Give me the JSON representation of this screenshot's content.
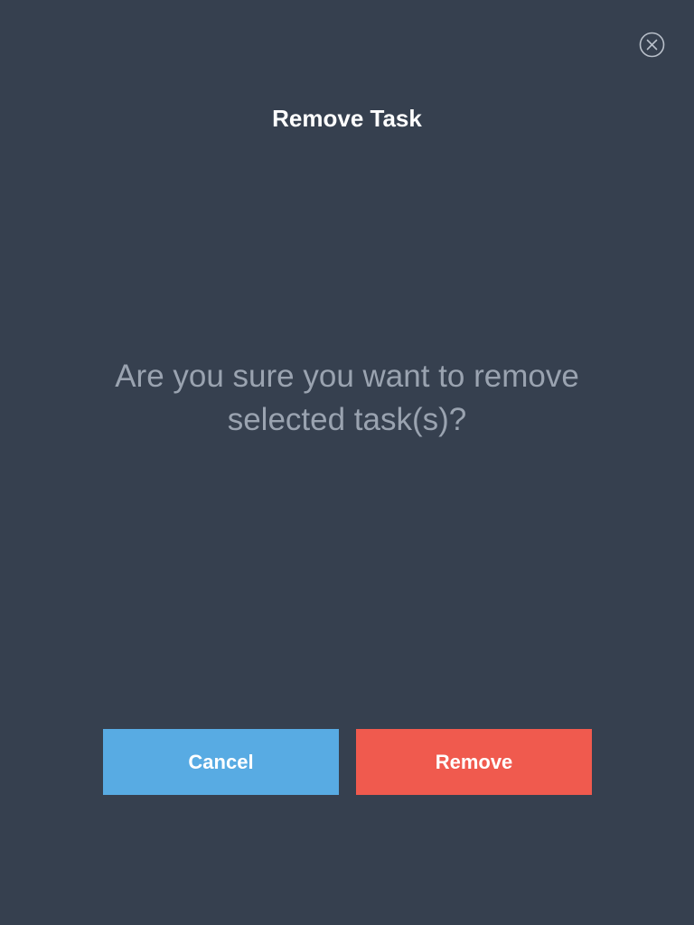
{
  "dialog": {
    "title": "Remove Task",
    "message": "Are you sure you want to remove selected task(s)?",
    "close_icon": "close-circle-icon"
  },
  "buttons": {
    "cancel_label": "Cancel",
    "remove_label": "Remove"
  },
  "colors": {
    "background": "#36404f",
    "cancel": "#58abe3",
    "remove": "#f05a4e",
    "message_text": "#9aa3b0"
  }
}
